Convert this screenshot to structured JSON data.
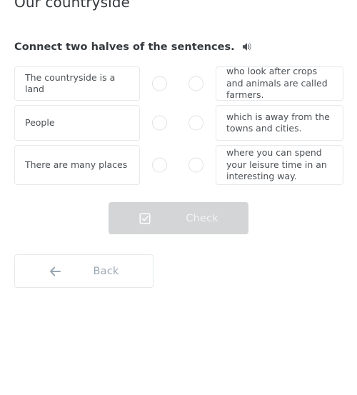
{
  "page": {
    "title": "Our countryside"
  },
  "exercise": {
    "instruction": "Connect two halves of the sentences.",
    "audio_icon": "speaker-icon",
    "left_items": [
      {
        "text": "The countryside is a land"
      },
      {
        "text": "People"
      },
      {
        "text": "There are many places"
      }
    ],
    "right_items": [
      {
        "text": "who look after crops and animals are called farmers."
      },
      {
        "text": "which is away from the towns and cities."
      },
      {
        "text": "where you can spend your leisure time in an interesting way."
      }
    ]
  },
  "actions": {
    "check": {
      "label": "Check",
      "icon": "checkbox-checked-icon",
      "disabled": true,
      "background": "#d3d5d6",
      "text_color": "#f2f3f4"
    },
    "back": {
      "label": "Back",
      "icon": "arrow-left-icon",
      "border_color": "#e4e8ea",
      "text_color": "#9aa7b2"
    }
  },
  "colors": {
    "page_background": "#ffffff",
    "card_border": "#e6e8ea",
    "card_text": "#4b5055",
    "dot_border": "#dfe2e5",
    "title_text": "#33383d",
    "instruction_text": "#353a3f"
  }
}
